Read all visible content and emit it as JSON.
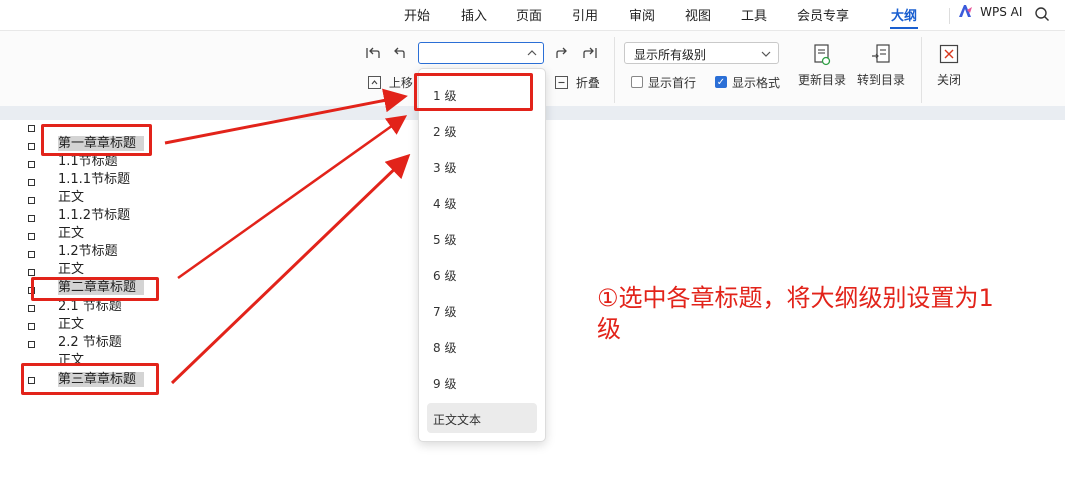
{
  "menu": {
    "items": [
      "开始",
      "插入",
      "页面",
      "引用",
      "审阅",
      "视图",
      "工具",
      "会员专享",
      "大纲"
    ],
    "active": "大纲",
    "wps_ai": "WPS AI"
  },
  "toolbar": {
    "move_up_label": "上移",
    "collapse_label": "折叠",
    "level_value": "",
    "show_level_value": "显示所有级别",
    "show_first_line_label": "显示首行",
    "show_first_line_checked": false,
    "show_format_label": "显示格式",
    "show_format_checked": true,
    "update_toc_label": "更新目录",
    "goto_toc_label": "转到目录",
    "close_label": "关闭"
  },
  "dropdown": {
    "options": [
      "1 级",
      "2 级",
      "3 级",
      "4 级",
      "5 级",
      "6 级",
      "7 级",
      "8 级",
      "9 级"
    ],
    "body_text": "正文文本"
  },
  "outline": {
    "lines": [
      "第一章章标题",
      "1.1节标题",
      "1.1.1节标题",
      "正文",
      "1.1.2节标题",
      "正文",
      "1.2节标题",
      "正文",
      "第二章章标题",
      "2.1  节标题",
      "正文",
      "2.2  节标题",
      "正文",
      "第三章章标题"
    ]
  },
  "annotation": "①选中各章标题，将大纲级别设置为1级",
  "colors": {
    "accent": "#1a5fd0",
    "annotation_red": "#e2231a",
    "highlight": "#d4d4d4"
  }
}
